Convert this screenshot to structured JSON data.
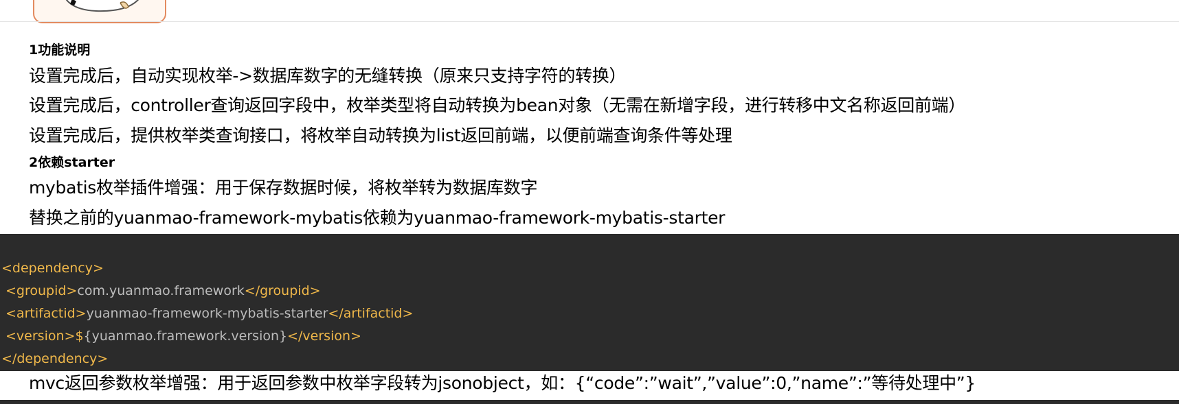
{
  "section1": {
    "heading": "1功能说明",
    "lines": [
      "设置完成后，自动实现枚举->数据库数字的无缝转换（原来只支持字符的转换）",
      "设置完成后，controller查询返回字段中，枚举类型将自动转换为bean对象（无需在新增字段，进行转移中文名称返回前端）",
      "设置完成后，提供枚举类查询接口，将枚举自动转换为list返回前端，以便前端查询条件等处理"
    ]
  },
  "section2": {
    "heading": "2依赖starter",
    "lines": [
      "mybatis枚举插件增强：用于保存数据时候，将枚举转为数据库数字",
      "替换之前的yuanmao-framework-mybatis依赖为yuanmao-framework-mybatis-starter"
    ]
  },
  "code": {
    "dependency_open": "<dependency>",
    "groupid_open": "<groupid>",
    "groupid_value": "com.yuanmao.framework",
    "groupid_close": "</groupid>",
    "artifactid_open": "<artifactid>",
    "artifactid_value": "yuanmao-framework-mybatis-starter",
    "artifactid_close": "</artifactid>",
    "version_open": "<version>",
    "version_dollar": "$",
    "version_value": "{yuanmao.framework.version}",
    "version_close": "</version>",
    "dependency_close": "</dependency>"
  },
  "footer_line": "mvc返回参数枚举增强：用于返回参数中枚举字段转为jsonobject，如：{“code”:”wait”,”value”:0,”name”:”等待处理中”}",
  "colors": {
    "code_bg": "#2b2b2b",
    "tag": "#f0b84a",
    "code_text": "#bcbcbc",
    "cartoon_border": "#e38b60"
  }
}
